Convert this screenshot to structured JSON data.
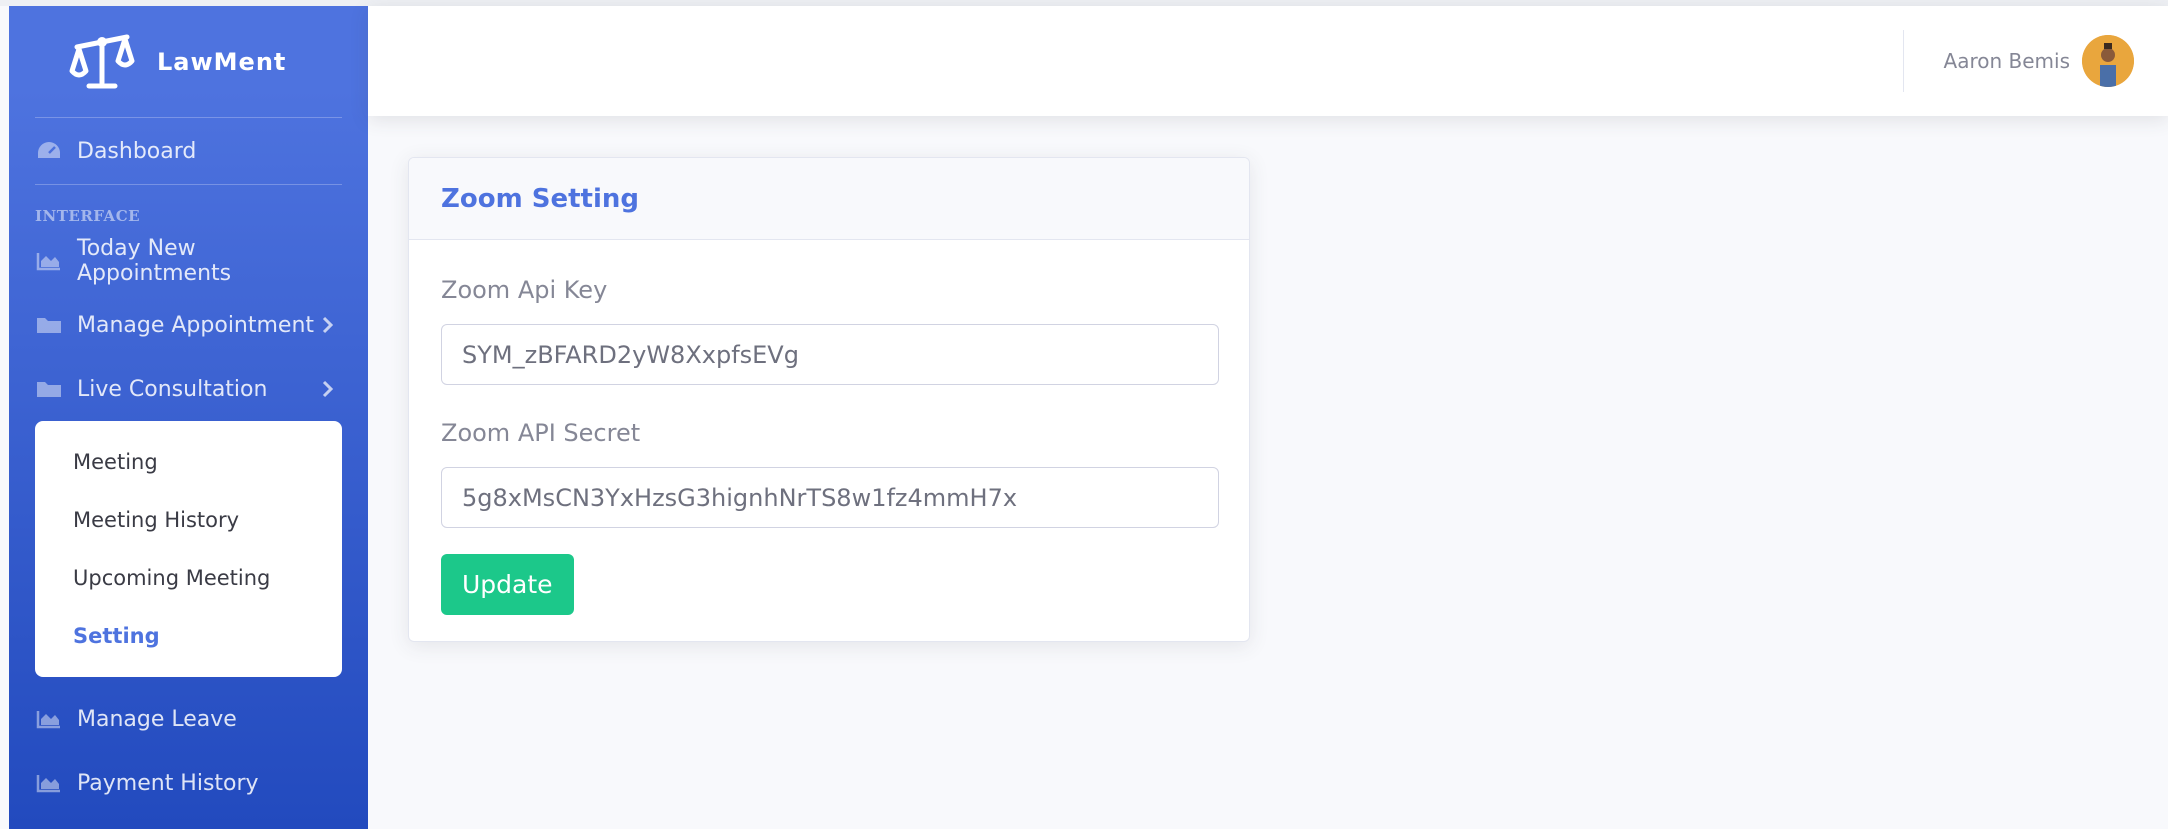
{
  "app": {
    "name": "LawMent"
  },
  "sidebar": {
    "dashboard": "Dashboard",
    "heading": "INTERFACE",
    "items": [
      {
        "label": "Today New Appointments",
        "icon": "chart-area-icon",
        "has_arrow": false
      },
      {
        "label": "Manage Appointment",
        "icon": "folder-icon",
        "has_arrow": true
      },
      {
        "label": "Live Consultation",
        "icon": "folder-icon",
        "has_arrow": true
      }
    ],
    "submenu": [
      {
        "label": "Meeting",
        "active": false
      },
      {
        "label": "Meeting History",
        "active": false
      },
      {
        "label": "Upcoming Meeting",
        "active": false
      },
      {
        "label": "Setting",
        "active": true
      }
    ],
    "bottom_items": [
      {
        "label": "Manage Leave",
        "icon": "chart-area-icon"
      },
      {
        "label": "Payment History",
        "icon": "chart-area-icon"
      }
    ]
  },
  "topbar": {
    "user_name": "Aaron Bemis"
  },
  "card": {
    "title": "Zoom Setting",
    "api_key_label": "Zoom Api Key",
    "api_key_value": "SYM_zBFARD2yW8XxpfsEVg",
    "api_secret_label": "Zoom API Secret",
    "api_secret_value": "5g8xMsCN3YxHzsG3hignhNrTS8w1fz4mmH7x",
    "update_label": "Update"
  },
  "colors": {
    "primary": "#4e73df",
    "success": "#1cc88a",
    "sidebar_gradient_end": "#224abe"
  }
}
